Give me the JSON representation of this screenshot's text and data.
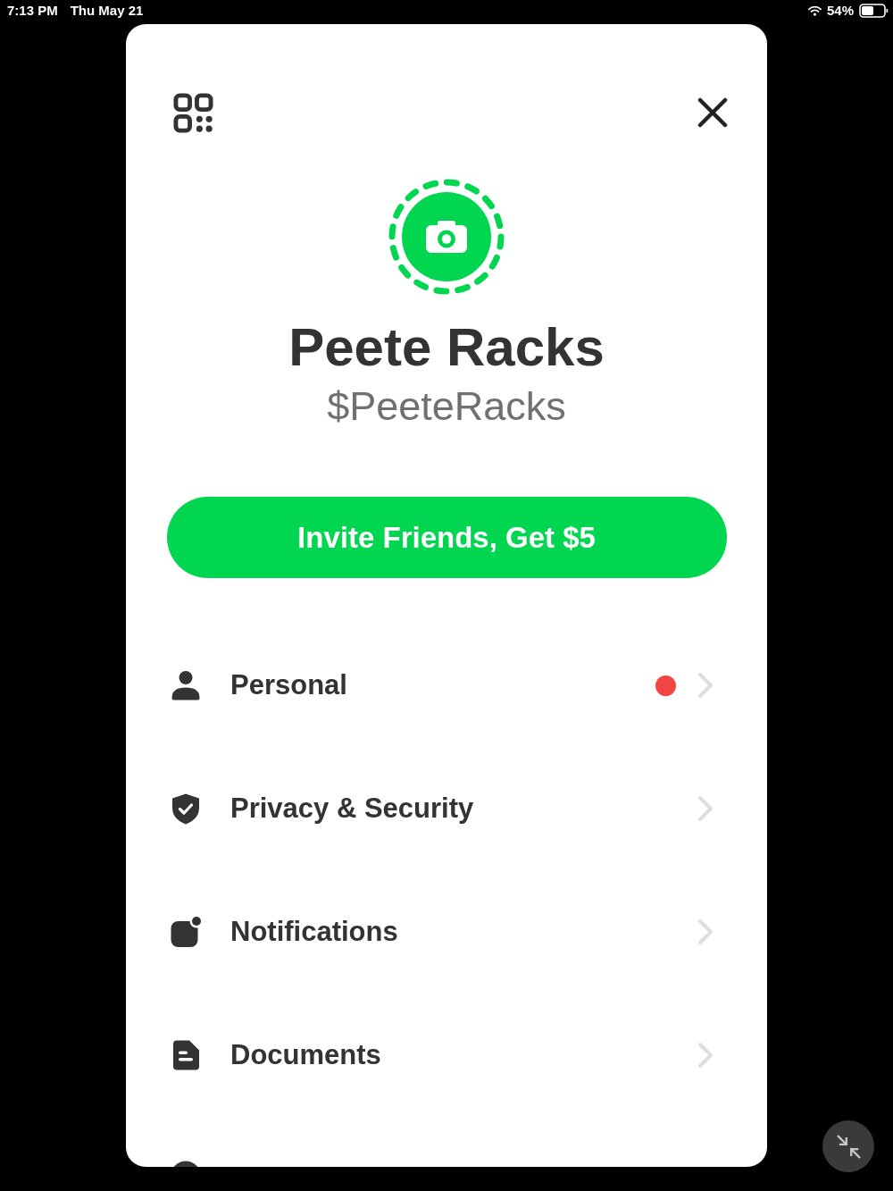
{
  "status_bar": {
    "time": "7:13 PM",
    "date": "Thu May 21",
    "battery_percent": "54%"
  },
  "profile": {
    "name": "Peete Racks",
    "cashtag": "$PeeteRacks"
  },
  "invite_button": {
    "label": "Invite Friends, Get $5"
  },
  "menu": [
    {
      "kind": "row",
      "label": "Personal",
      "alert": true
    },
    {
      "kind": "row",
      "label": "Privacy & Security",
      "alert": false
    },
    {
      "kind": "row",
      "label": "Notifications",
      "alert": false
    },
    {
      "kind": "row",
      "label": "Documents",
      "alert": false
    },
    {
      "kind": "cut_off"
    }
  ]
}
